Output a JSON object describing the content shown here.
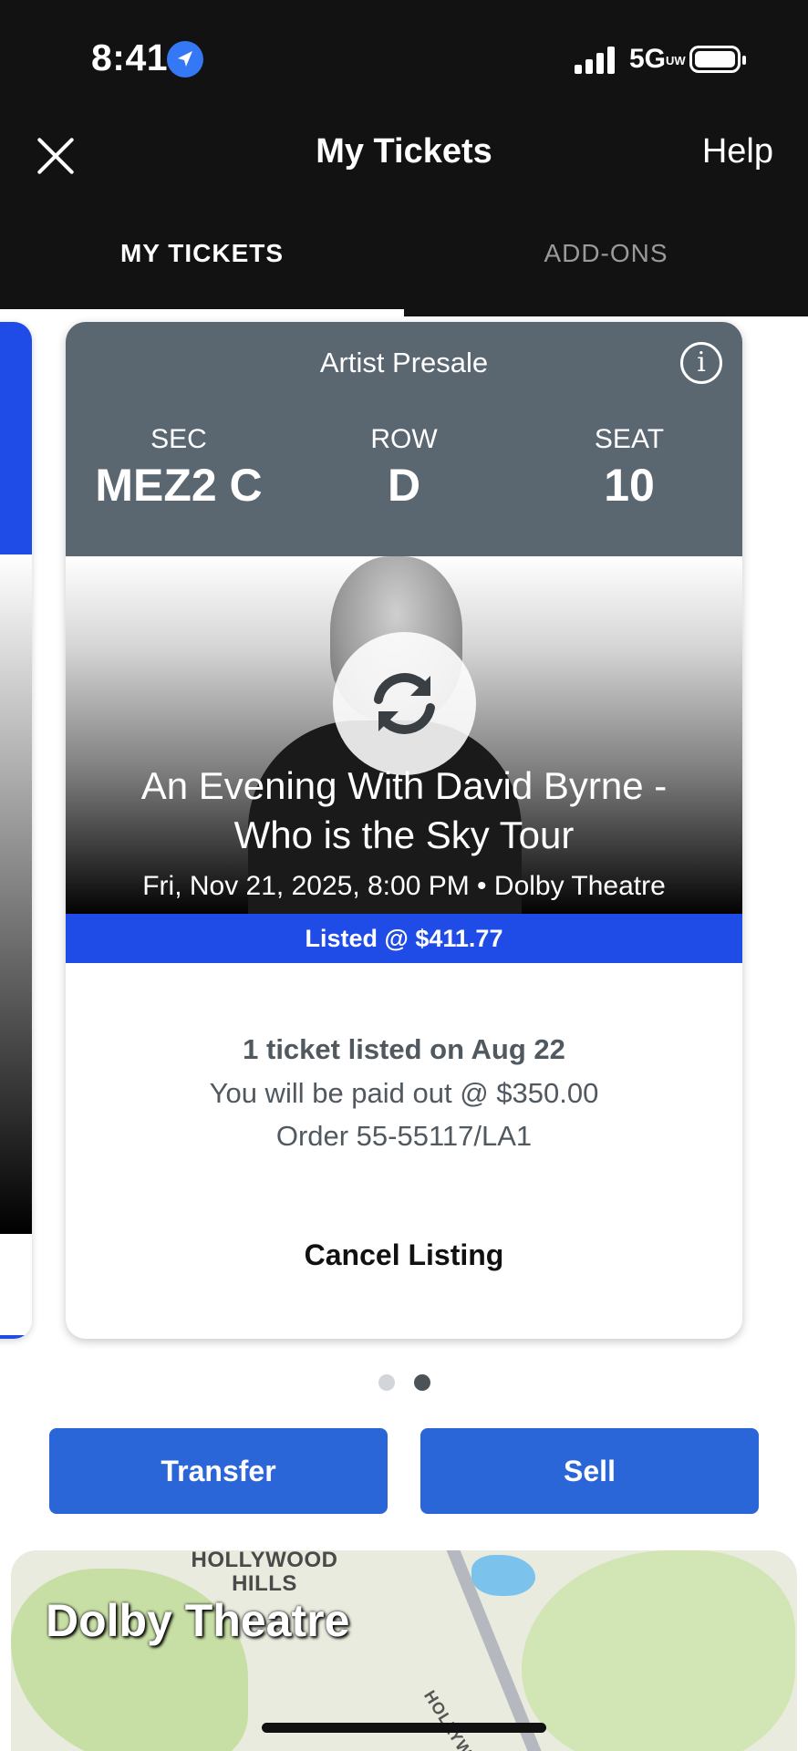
{
  "status_bar": {
    "time": "8:41",
    "network": "5G",
    "network_suffix": "UW"
  },
  "nav": {
    "title": "My Tickets",
    "help_label": "Help"
  },
  "tabs": [
    {
      "label": "MY TICKETS",
      "active": true
    },
    {
      "label": "ADD-ONS",
      "active": false
    }
  ],
  "ticket": {
    "presale_label": "Artist Presale",
    "section_label": "SEC",
    "section_value": "MEZ2 C",
    "row_label": "ROW",
    "row_value": "D",
    "seat_label": "SEAT",
    "seat_value": "10",
    "event_title_line1": "An Evening With David Byrne -",
    "event_title_line2": "Who is the Sky Tour",
    "event_meta": "Fri, Nov 21, 2025, 8:00 PM • Dolby Theatre",
    "listed_label": "Listed @ $411.77",
    "listing_summary": "1 ticket listed on Aug 22",
    "payout": "You will be paid out @ $350.00",
    "order": "Order 55-55117/LA1",
    "cancel_label": "Cancel Listing"
  },
  "pagination": {
    "current": 2,
    "total": 2
  },
  "actions": {
    "transfer_label": "Transfer",
    "sell_label": "Sell"
  },
  "map": {
    "area_label_line1": "HOLLYWOOD",
    "area_label_line2": "HILLS",
    "venue_label": "Dolby Theatre",
    "road_label": "HOLLYWOOD"
  },
  "colors": {
    "topbar": "#121212",
    "card_header": "#5a6670",
    "listed_bar": "#1f4be6",
    "action_button": "#2b66d9"
  }
}
